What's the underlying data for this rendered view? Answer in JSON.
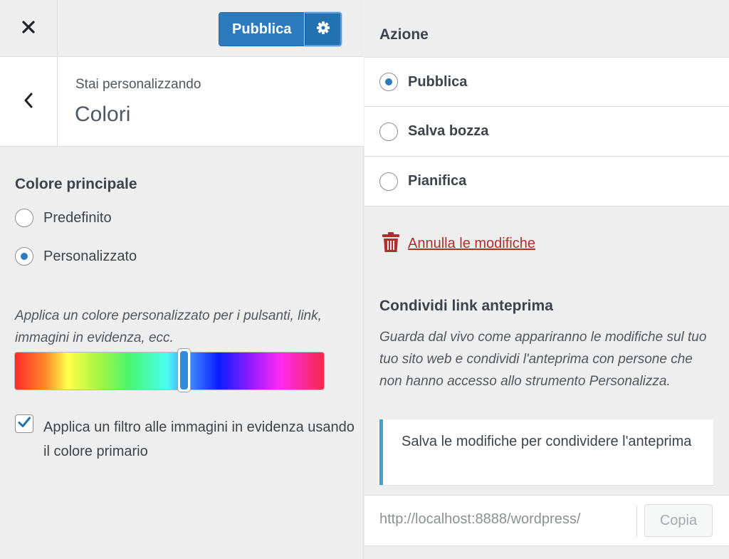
{
  "header": {
    "publish_label": "Pubblica"
  },
  "section": {
    "customizing_label": "Stai personalizzando",
    "name": "Colori"
  },
  "color_control": {
    "title": "Colore principale",
    "options": [
      {
        "label": "Predefinito",
        "checked": false
      },
      {
        "label": "Personalizzato",
        "checked": true
      }
    ],
    "description": "Applica un colore personalizzato per i pulsanti, link, immagini in evidenza, ecc.",
    "hue_slider_value_fraction": 0.55,
    "filter_checkbox": {
      "label": "Applica un filtro alle immagini in evidenza usando il colore primario",
      "checked": true
    }
  },
  "publish_settings": {
    "action_title": "Azione",
    "actions": [
      {
        "label": "Pubblica",
        "checked": true
      },
      {
        "label": "Salva bozza",
        "checked": false
      },
      {
        "label": "Pianifica",
        "checked": false
      }
    ],
    "discard_label": "Annulla le modifiche",
    "share_title": "Condividi link anteprima",
    "share_description": "Guarda dal vivo come appariranno le modifiche sul tuo tuo sito web e condividi l'anteprima con persone che non hanno accesso allo strumento Personalizza.",
    "share_notice": "Salva le modifiche per condividere l'anteprima",
    "preview_url": "http://localhost:8888/wordpress/",
    "copy_label": "Copia"
  },
  "colors": {
    "primary": "#2c7bbf",
    "danger": "#b32d2e",
    "notice_border": "#3da3d4"
  },
  "icons": [
    "close-icon",
    "gear-icon",
    "chevron-left-icon",
    "trash-icon",
    "checkmark-icon"
  ]
}
